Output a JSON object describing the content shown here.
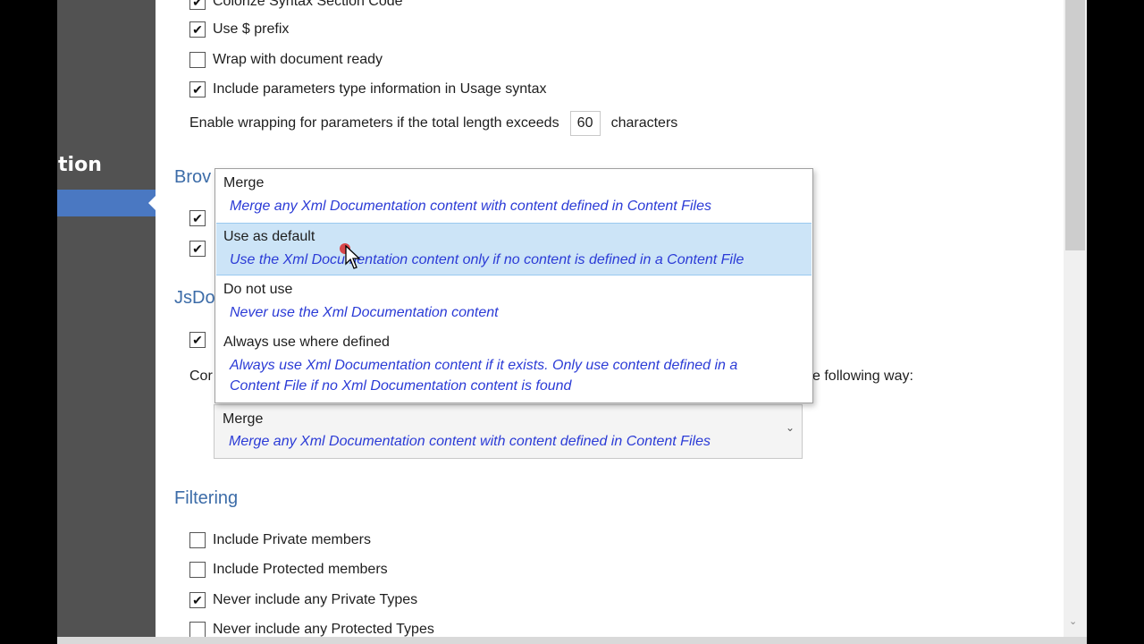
{
  "sidebar": {
    "title": "ntation"
  },
  "options_top": [
    {
      "label": "Colorize Syntax Section Code",
      "checked": true
    },
    {
      "label": "Use $ prefix",
      "checked": true
    },
    {
      "label": "Wrap with document ready",
      "checked": false
    },
    {
      "label": "Include parameters type information in Usage syntax",
      "checked": true
    }
  ],
  "wrapping": {
    "prefix": "Enable wrapping for parameters if the total length exceeds",
    "value": "60",
    "suffix": "characters"
  },
  "sections": {
    "browser_partial": "Brov",
    "jsdoc_partial": "JsDo",
    "filtering": "Filtering"
  },
  "obscured": {
    "line_prefix": "Cor",
    "line_suffix": "e following way:"
  },
  "combo": {
    "selected_title": "Merge",
    "selected_desc": "Merge any Xml Documentation content with content defined in Content Files"
  },
  "dropdown": {
    "items": [
      {
        "title": "Merge",
        "desc": "Merge any Xml Documentation content with content defined in Content Files",
        "selected": false
      },
      {
        "title": "Use as default",
        "desc": "Use the Xml Documentation content only if no content is defined in a Content File",
        "selected": true
      },
      {
        "title": "Do not use",
        "desc": "Never use the Xml Documentation content",
        "selected": false
      },
      {
        "title": "Always use where defined",
        "desc_line1": "Always use Xml Documentation content if it exists. Only use content defined in a",
        "desc_line2": "Content File if no Xml Documentation content is found",
        "selected": false
      }
    ]
  },
  "filtering": [
    {
      "label": "Include Private members",
      "checked": false
    },
    {
      "label": "Include Protected members",
      "checked": false
    },
    {
      "label": "Never include any Private Types",
      "checked": true
    },
    {
      "label": "Never include any Protected Types",
      "checked": false
    }
  ],
  "checkmark": "✔",
  "chevron": "⌄",
  "colors": {
    "accent": "#3c6ca8",
    "sidebar": "#525252",
    "sidebar_selected": "#4a78c2",
    "description": "#2b3bd6",
    "dropdown_selected": "#cce4f7"
  }
}
